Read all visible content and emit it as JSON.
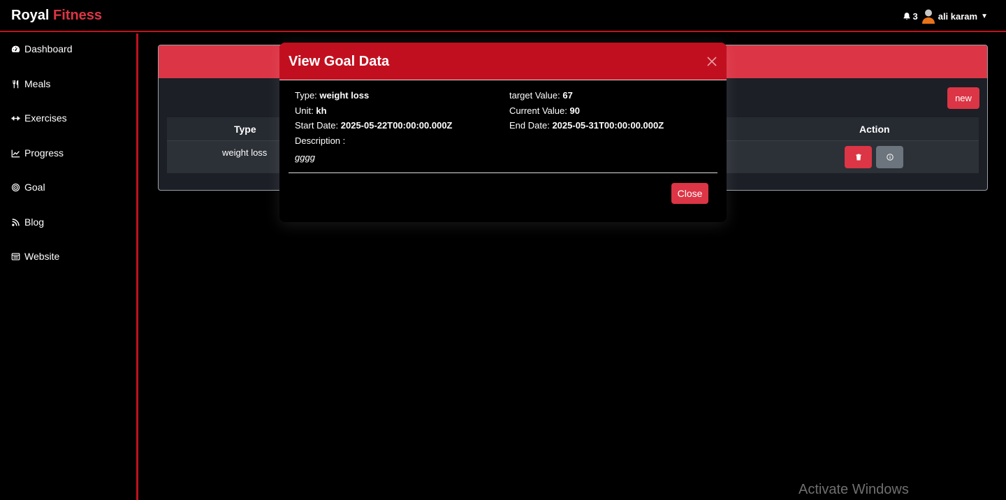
{
  "brand": {
    "part1": "Royal",
    "part2": "Fitness"
  },
  "topbar": {
    "notification_count": "3",
    "username": "ali karam"
  },
  "sidebar": {
    "items": [
      {
        "label": "Dashboard",
        "icon": "gauge-icon"
      },
      {
        "label": "Meals",
        "icon": "utensils-icon"
      },
      {
        "label": "Exercises",
        "icon": "dumbbell-icon"
      },
      {
        "label": "Progress",
        "icon": "chart-line-icon"
      },
      {
        "label": "Goal",
        "icon": "target-icon"
      },
      {
        "label": "Blog",
        "icon": "blog-icon"
      },
      {
        "label": "Website",
        "icon": "window-icon"
      }
    ]
  },
  "card": {
    "new_label": "new",
    "table": {
      "headers": {
        "type": "Type",
        "action": "Action"
      },
      "rows": [
        {
          "type": "weight loss"
        }
      ]
    }
  },
  "modal": {
    "title": "View Goal Data",
    "type_label": "Type:",
    "type_value": "weight loss",
    "target_label": "target Value:",
    "target_value": "67",
    "unit_label": "Unit:",
    "unit_value": "kh",
    "current_label": "Current Value:",
    "current_value": "90",
    "start_label": "Start Date:",
    "start_value": "2025-05-22T00:00:00.000Z",
    "end_label": "End Date:",
    "end_value": "2025-05-31T00:00:00.000Z",
    "description_label": "Description :",
    "description_value": "gggg",
    "close_label": "Close"
  },
  "watermark": "Activate Windows",
  "colors": {
    "accent": "#dc3545",
    "modal_header": "#c20f1f",
    "border_red": "#c0111f"
  }
}
